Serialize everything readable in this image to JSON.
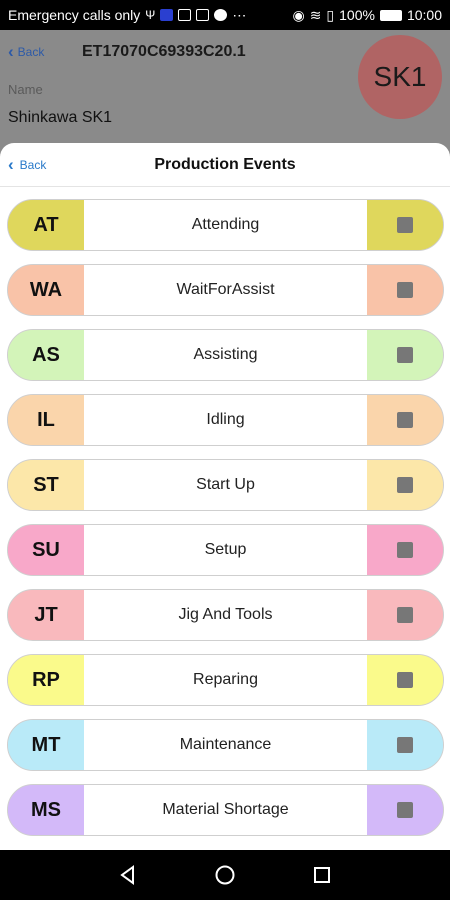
{
  "status_bar": {
    "carrier": "Emergency calls only",
    "battery": "100%",
    "time": "10:00"
  },
  "background": {
    "back_label": "Back",
    "title": "ET17070C69393C20.1",
    "name_label": "Name",
    "name_value": "Shinkawa SK1",
    "avatar_text": "SK1"
  },
  "sheet": {
    "back_label": "Back",
    "title": "Production Events",
    "events": [
      {
        "code": "AT",
        "name": "Attending",
        "color": "#dfd75c"
      },
      {
        "code": "WA",
        "name": "WaitForAssist",
        "color": "#f9c3a8"
      },
      {
        "code": "AS",
        "name": "Assisting",
        "color": "#d3f4b9"
      },
      {
        "code": "IL",
        "name": "Idling",
        "color": "#fad5ab"
      },
      {
        "code": "ST",
        "name": "Start Up",
        "color": "#fce7a9"
      },
      {
        "code": "SU",
        "name": "Setup",
        "color": "#f8a8c9"
      },
      {
        "code": "JT",
        "name": "Jig And Tools",
        "color": "#f9b9bd"
      },
      {
        "code": "RP",
        "name": "Reparing",
        "color": "#fafa8b"
      },
      {
        "code": "MT",
        "name": "Maintenance",
        "color": "#b9eaf8"
      },
      {
        "code": "MS",
        "name": "Material Shortage",
        "color": "#d3b9f9"
      }
    ]
  }
}
